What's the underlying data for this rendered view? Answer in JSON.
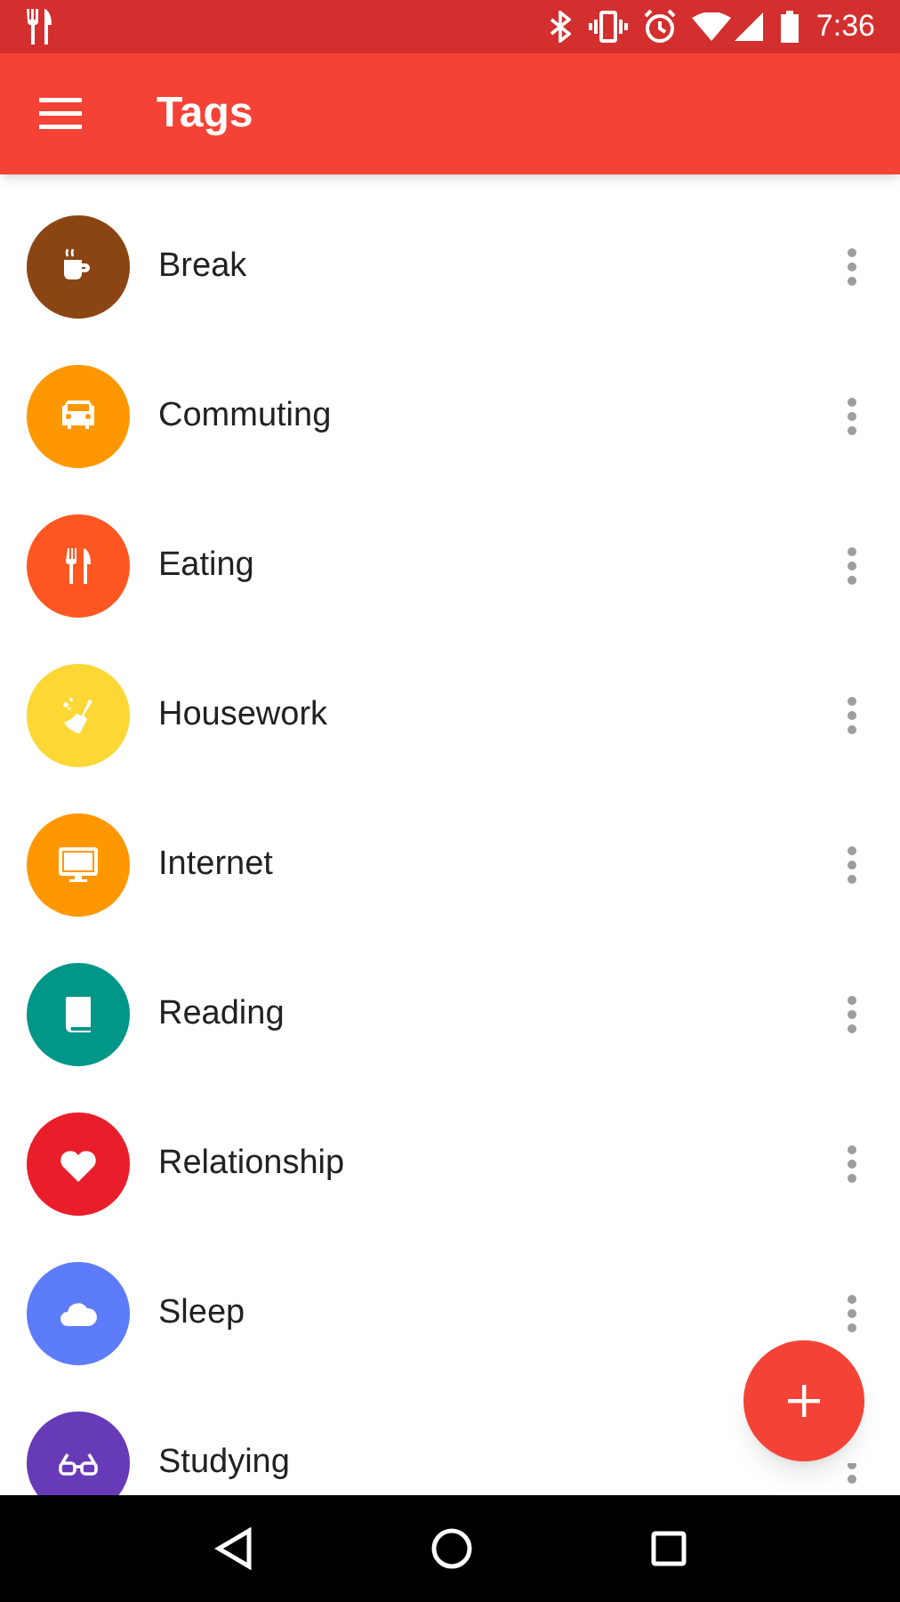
{
  "status_bar": {
    "time": "7:36"
  },
  "app_bar": {
    "title": "Tags"
  },
  "tags": [
    {
      "label": "Break",
      "kind": "coffee",
      "color": "#8b4513"
    },
    {
      "label": "Commuting",
      "kind": "car",
      "color": "#ff9800"
    },
    {
      "label": "Eating",
      "kind": "cutlery",
      "color": "#ff5722"
    },
    {
      "label": "Housework",
      "kind": "broom",
      "color": "#fdd835"
    },
    {
      "label": "Internet",
      "kind": "monitor",
      "color": "#ff9800"
    },
    {
      "label": "Reading",
      "kind": "book",
      "color": "#009688"
    },
    {
      "label": "Relationship",
      "kind": "heart",
      "color": "#e91e2a"
    },
    {
      "label": "Sleep",
      "kind": "cloud",
      "color": "#5c7cfa"
    },
    {
      "label": "Studying",
      "kind": "glasses",
      "color": "#673ab7"
    }
  ]
}
